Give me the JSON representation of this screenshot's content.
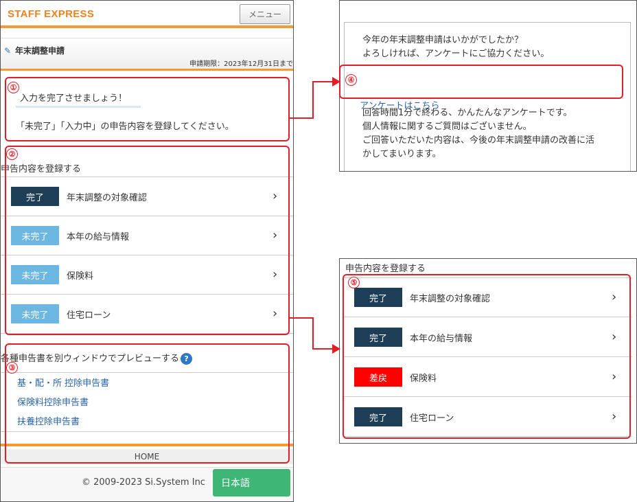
{
  "header": {
    "brand": "STAFF EXPRESS",
    "menu_label": "メニュー"
  },
  "title_bar": {
    "title": "年末調整申請",
    "deadline": "申請期限：2023年12月31日まで"
  },
  "prompt": {
    "line1": "入力を完了させましょう！",
    "line2": "「未完了」「入力中」の申告内容を登録してください。"
  },
  "register": {
    "heading": "申告内容を登録する",
    "rows": [
      {
        "status": "完了",
        "label": "年末調整の対象確認"
      },
      {
        "status": "未完了",
        "label": "本年の給与情報"
      },
      {
        "status": "未完了",
        "label": "保険料"
      },
      {
        "status": "未完了",
        "label": "住宅ローン"
      }
    ]
  },
  "preview": {
    "heading": "各種申告書を別ウィンドウでプレビューする",
    "help_glyph": "?",
    "links": [
      "基・配・所 控除申告書",
      "保険料控除申告書",
      "扶養控除申告書"
    ]
  },
  "footer": {
    "home_label": "HOME",
    "copyright": "© 2009-2023 Si.System Inc",
    "language_label": "日本語"
  },
  "annotations": [
    "①",
    "②",
    "③",
    "④",
    "⑤"
  ],
  "survey": {
    "line1": "今年の年末調整申請はいかがでしたか？",
    "line2": "よろしければ、アンケートにご協力ください。",
    "link_label": "アンケートはこちら",
    "line3": "回答時間1分で終わる、かんたんなアンケートです。",
    "line4": "個人情報に関するご質問はございません。",
    "line5": "ご回答いただいた内容は、今後の年末調整申請の改善に活",
    "line6": "かしてまいります。"
  },
  "register_after": {
    "heading": "申告内容を登録する",
    "rows": [
      {
        "status": "完了",
        "label": "年末調整の対象確認"
      },
      {
        "status": "完了",
        "label": "本年の給与情報"
      },
      {
        "status": "差戻",
        "label": "保険料"
      },
      {
        "status": "完了",
        "label": "住宅ローン"
      }
    ]
  },
  "colors": {
    "brand": "#f0821e",
    "accent_bar": "#f39a33",
    "status_done": "#1e3d57",
    "status_todo": "#6cb7e1",
    "status_returned": "#ff0000",
    "annotation_red": "#e21f26",
    "link": "#2a63a8",
    "language_button": "#3db676"
  },
  "icons": {
    "title_icon": "pencil-icon",
    "row_chevron": "chevron-right-icon",
    "help": "question-circle-icon",
    "connector": "arrow-right-icon"
  }
}
